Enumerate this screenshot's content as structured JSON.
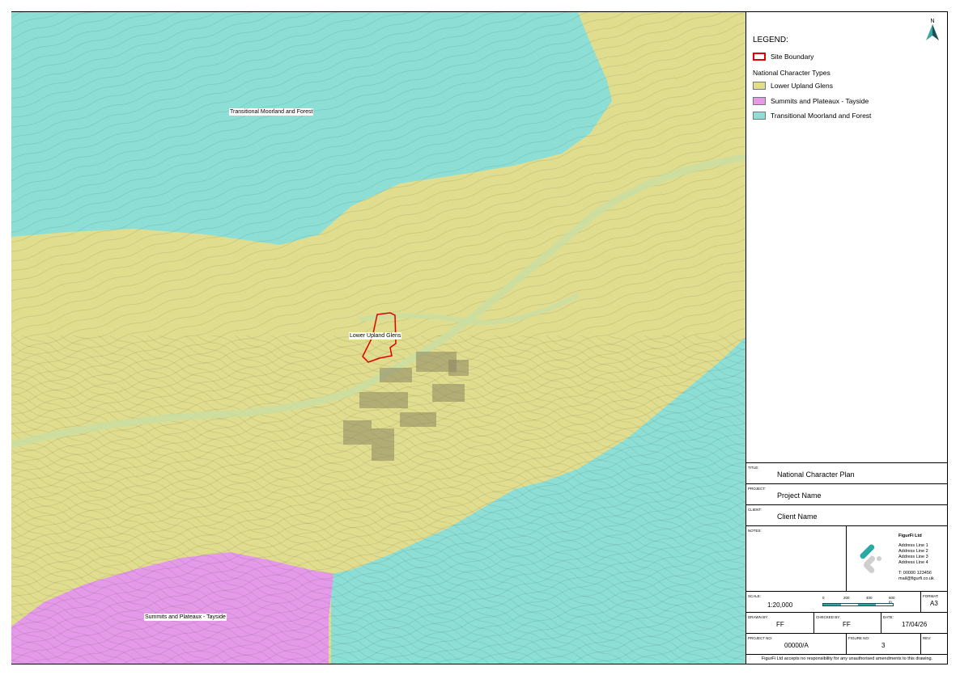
{
  "map": {
    "labels": {
      "moorland": "Transitional Moorland and Forest",
      "glens": "Lower Upland Glens",
      "summits": "Summits and Plateaux - Tayside"
    },
    "colors": {
      "moorland": "#8ddfd6",
      "glens": "#e0dd8f",
      "summits": "#e49ae8",
      "site_boundary": "#e00000"
    }
  },
  "legend": {
    "title": "LEGEND:",
    "north": "N",
    "site_boundary": "Site Boundary",
    "subheading": "National Character Types",
    "items": [
      {
        "label": "Lower Upland Glens",
        "color": "#e0dd8f"
      },
      {
        "label": "Summits and Plateaux - Tayside",
        "color": "#e49ae8"
      },
      {
        "label": "Transitional Moorland and Forest",
        "color": "#8ddfd6"
      }
    ]
  },
  "title_block": {
    "title_label": "TITLE:",
    "title": "National Character Plan",
    "project_label": "PROJECT:",
    "project": "Project Name",
    "client_label": "CLIENT:",
    "client": "Client Name",
    "notes_label": "NOTES:",
    "company": {
      "name": "FigurFi Ltd",
      "address": [
        "Address Line 1",
        "Address Line 2",
        "Address Line 3",
        "Address Line 4"
      ],
      "phone": "T: 00000 123456",
      "email": "mail@figurfi.co.uk"
    },
    "scale_label": "SCALE:",
    "scale": "1:20,000",
    "scale_ticks": [
      "0",
      "200",
      "400",
      "600 m"
    ],
    "format_label": "FORMAT:",
    "format": "A3",
    "drawn_by_label": "DRAWN BY:",
    "drawn_by": "FF",
    "checked_by_label": "CHECKED BY:",
    "checked_by": "FF",
    "date_label": "DATE:",
    "date": "17/04/26",
    "project_no_label": "PROJECT NO:",
    "project_no": "00000/A",
    "figure_no_label": "FIGURE NO:",
    "figure_no": "3",
    "rev_label": "REV:",
    "rev": "",
    "disclaimer": "FigurFi Ltd accepts no responsibility for any unauthorised amendments to this drawing."
  }
}
